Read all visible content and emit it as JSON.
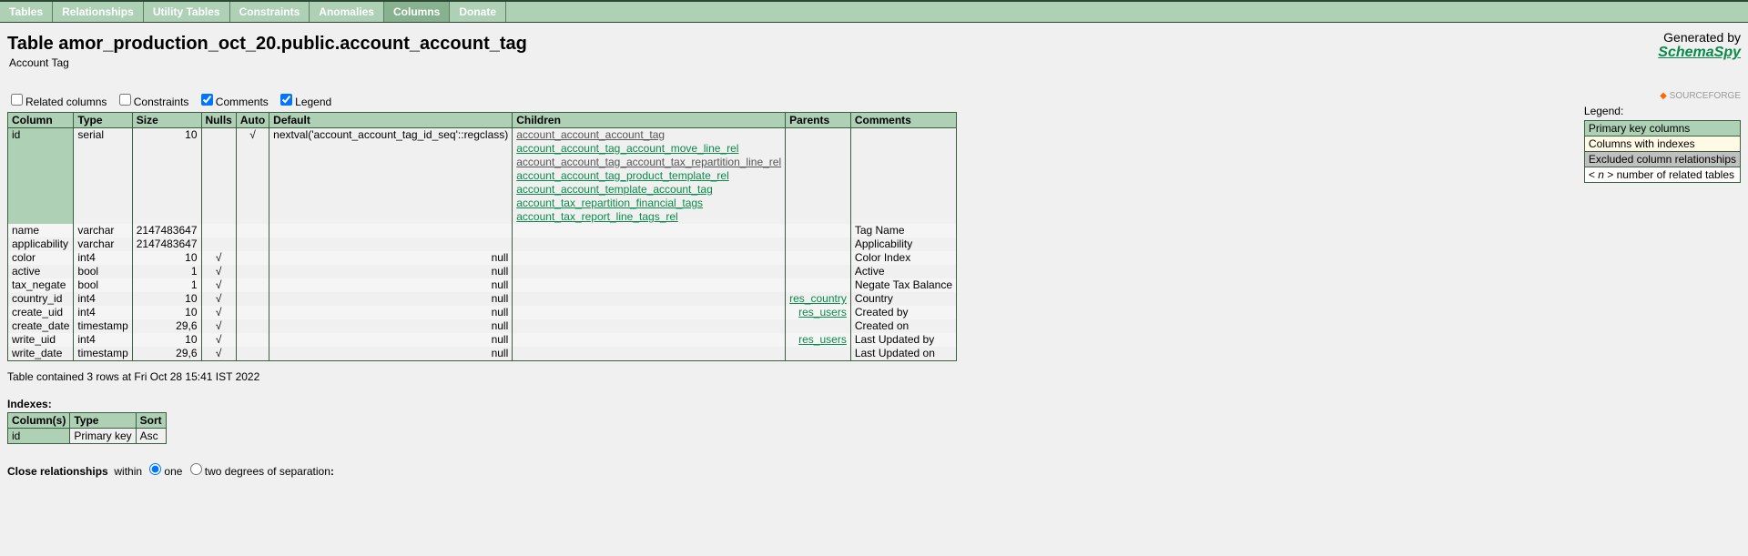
{
  "tabs": [
    "Tables",
    "Relationships",
    "Utility Tables",
    "Constraints",
    "Anomalies",
    "Columns",
    "Donate"
  ],
  "activeTab": 5,
  "title": "Table amor_production_oct_20.public.account_account_tag",
  "subtitle": "Account Tag",
  "generatedLabel": "Generated by",
  "brand": "SchemaSpy",
  "sourceforge": "SOURCEFORGE",
  "checkboxes": {
    "related": {
      "label": "Related columns",
      "checked": false
    },
    "constraints": {
      "label": "Constraints",
      "checked": false
    },
    "comments": {
      "label": "Comments",
      "checked": true
    },
    "legend": {
      "label": "Legend",
      "checked": true
    }
  },
  "legendTitle": "Legend:",
  "legend": [
    {
      "cls": "tc-pk",
      "text": "Primary key columns"
    },
    {
      "cls": "tc-idx",
      "text": "Columns with indexes"
    },
    {
      "cls": "tc-excl",
      "text": "Excluded column relationships"
    },
    {
      "cls": "tc-num",
      "text": "< n > number of related tables"
    }
  ],
  "headers": [
    "Column",
    "Type",
    "Size",
    "Nulls",
    "Auto",
    "Default",
    "Children",
    "Parents",
    "Comments"
  ],
  "rows": [
    {
      "pk": true,
      "alt": false,
      "col": "id",
      "type": "serial",
      "size": "10",
      "nulls": "",
      "auto": "√",
      "default": "nextval('account_account_tag_id_seq'::regclass)",
      "children": [
        {
          "excl": true,
          "text": "account_account_account_tag"
        },
        {
          "excl": false,
          "text": "account_account_tag_account_move_line_rel"
        },
        {
          "excl": true,
          "text": "account_account_tag_account_tax_repartition_line_rel"
        },
        {
          "excl": false,
          "text": "account_account_tag_product_template_rel"
        },
        {
          "excl": false,
          "text": "account_account_template_account_tag"
        },
        {
          "excl": false,
          "text": "account_tax_repartition_financial_tags"
        },
        {
          "excl": false,
          "text": "account_tax_report_line_tags_rel"
        }
      ],
      "parents": [],
      "comments": ""
    },
    {
      "pk": false,
      "alt": true,
      "col": "name",
      "type": "varchar",
      "size": "2147483647",
      "nulls": "",
      "auto": "",
      "default": "",
      "children": [],
      "parents": [],
      "comments": "Tag Name"
    },
    {
      "pk": false,
      "alt": false,
      "col": "applicability",
      "type": "varchar",
      "size": "2147483647",
      "nulls": "",
      "auto": "",
      "default": "",
      "children": [],
      "parents": [],
      "comments": "Applicability"
    },
    {
      "pk": false,
      "alt": true,
      "col": "color",
      "type": "int4",
      "size": "10",
      "nulls": "√",
      "auto": "",
      "default": "null",
      "children": [],
      "parents": [],
      "comments": "Color Index"
    },
    {
      "pk": false,
      "alt": false,
      "col": "active",
      "type": "bool",
      "size": "1",
      "nulls": "√",
      "auto": "",
      "default": "null",
      "children": [],
      "parents": [],
      "comments": "Active"
    },
    {
      "pk": false,
      "alt": true,
      "col": "tax_negate",
      "type": "bool",
      "size": "1",
      "nulls": "√",
      "auto": "",
      "default": "null",
      "children": [],
      "parents": [],
      "comments": "Negate Tax Balance"
    },
    {
      "pk": false,
      "alt": false,
      "col": "country_id",
      "type": "int4",
      "size": "10",
      "nulls": "√",
      "auto": "",
      "default": "null",
      "children": [],
      "parents": [
        {
          "text": "res_country"
        }
      ],
      "comments": "Country"
    },
    {
      "pk": false,
      "alt": true,
      "col": "create_uid",
      "type": "int4",
      "size": "10",
      "nulls": "√",
      "auto": "",
      "default": "null",
      "children": [],
      "parents": [
        {
          "text": "res_users"
        }
      ],
      "comments": "Created by"
    },
    {
      "pk": false,
      "alt": false,
      "col": "create_date",
      "type": "timestamp",
      "size": "29,6",
      "nulls": "√",
      "auto": "",
      "default": "null",
      "children": [],
      "parents": [],
      "comments": "Created on"
    },
    {
      "pk": false,
      "alt": true,
      "col": "write_uid",
      "type": "int4",
      "size": "10",
      "nulls": "√",
      "auto": "",
      "default": "null",
      "children": [],
      "parents": [
        {
          "text": "res_users"
        }
      ],
      "comments": "Last Updated by"
    },
    {
      "pk": false,
      "alt": false,
      "col": "write_date",
      "type": "timestamp",
      "size": "29,6",
      "nulls": "√",
      "auto": "",
      "default": "null",
      "children": [],
      "parents": [],
      "comments": "Last Updated on"
    }
  ],
  "rowCountInfo": "Table contained 3 rows at Fri Oct 28 15:41 IST 2022",
  "indexesTitle": "Indexes:",
  "idxHeaders": [
    "Column(s)",
    "Type",
    "Sort"
  ],
  "idxRows": [
    {
      "pk": true,
      "col": "id",
      "type": "Primary key",
      "sort": "Asc"
    }
  ],
  "closeRel": {
    "label": "Close relationships",
    "within": "within",
    "one": "one",
    "two": "two degrees of separation",
    "sep": ":"
  }
}
